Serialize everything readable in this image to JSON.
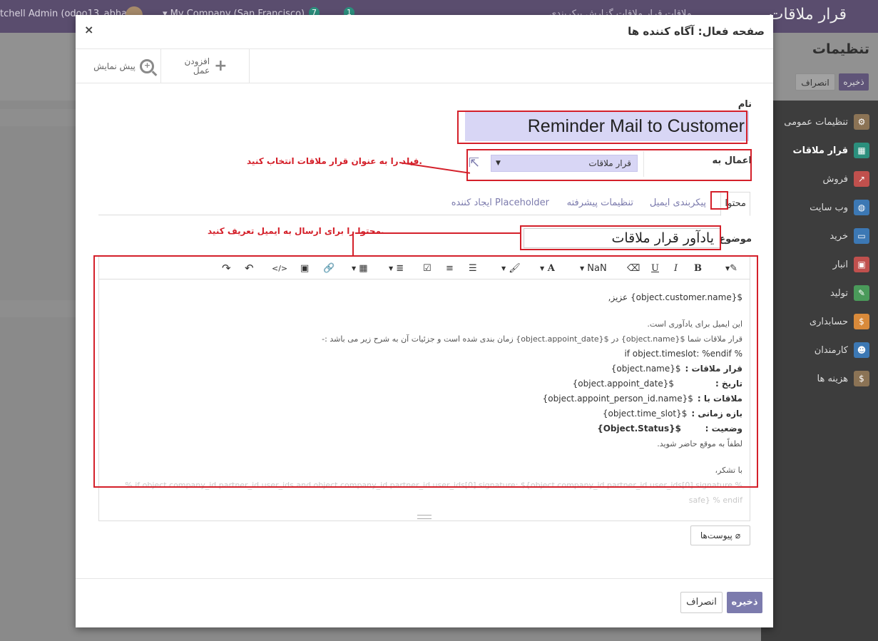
{
  "topbar": {
    "user": "tchell Admin (odoo13_abhasi)",
    "company": "▾ My Company (San Francisco)",
    "badge_msgs": "7",
    "badge_activity": "1",
    "menu_text": "ملاقات  قرار ملاقات  گزارش  پیکربندی",
    "brand": "قرار ملاقات"
  },
  "background": {
    "title": "تنظیمات",
    "save": "ذخیره",
    "cancel": "انصراف"
  },
  "sidebar": {
    "items": [
      {
        "label": "تنظیمات عمومی",
        "icon": "gear-icon",
        "color": "#8b7355"
      },
      {
        "label": "قرار ملاقات",
        "icon": "calendar-icon",
        "color": "#2b8f7d"
      },
      {
        "label": "فروش",
        "icon": "chart-icon",
        "color": "#c0504d"
      },
      {
        "label": "وب سایت",
        "icon": "globe-icon",
        "color": "#3c78b4"
      },
      {
        "label": "خرید",
        "icon": "card-icon",
        "color": "#3c78b4"
      },
      {
        "label": "انبار",
        "icon": "box-icon",
        "color": "#c0504d"
      },
      {
        "label": "تولید",
        "icon": "wrench-icon",
        "color": "#4a9a5a"
      },
      {
        "label": "حسابداری",
        "icon": "invoice-icon",
        "color": "#d98a3a"
      },
      {
        "label": "کارمندان",
        "icon": "people-icon",
        "color": "#3c78b4"
      },
      {
        "label": "هزینه ها",
        "icon": "expense-icon",
        "color": "#8b7355"
      }
    ]
  },
  "modal": {
    "title": "صفحه فعال: آگاه کننده ها",
    "close": "×",
    "preview": "پیش نمایش",
    "add_action": "افزودن\nعمل",
    "name_label": "نام",
    "name_value": "Reminder Mail to Customer",
    "apply_label": "اعمال به",
    "apply_value": "قرار ملاقات",
    "tabs": [
      "محتوا",
      "پیکربندی ایمیل",
      "تنظیمات پیشرفته",
      "ایجاد کننده Placeholder"
    ],
    "subject_label": "موضوع",
    "subject_value": "یادآور قرار ملاقات",
    "toolbar": {
      "style": "✎",
      "bold": "B",
      "italic": "I",
      "underline": "U",
      "eraser": "⌫",
      "font_size": "NaN",
      "font_color": "A",
      "brush": "🖌",
      "ul": "☰",
      "ol": "≡",
      "check": "☑",
      "align": "≣",
      "table": "▦",
      "link": "🔗",
      "image": "▣",
      "code": "</>",
      "undo": "↶",
      "redo": "↷"
    },
    "body": {
      "greet": "${object.customer.name} عزیز,",
      "l1": "این ایمیل برای یادآوری است.",
      "l2": "قرار ملاقات شما ${object.name} در ${object.appoint_date} زمان بندی شده است و جزئیات آن به شرح زیر می باشد :-",
      "l3": "% if object.timeslot: %endif",
      "r1k": "قرار ملاقات :",
      "r1v": "${object.name}",
      "r2k": "تاریخ :",
      "r2v": "${object.appoint_date}",
      "r3k": "ملاقات با :",
      "r3v": "${object.appoint_person_id.name}",
      "r4k": "بازه زمانی :",
      "r4v": "${object.time_slot}",
      "r5k": "وضعیت :",
      "r5v": "${Object.Status}",
      "l4": "لطفاً به موقع حاضر شوید.",
      "l5": "با تشکر،",
      "sig1": "% if object.company_id.partner_id.user_ids and object.company_id.partner_id.user_ids[0].signature: ${object.company_id.partner_id.user_ids[0].signature %",
      "sig2": "safe} % endif"
    },
    "attachments": "پیوست‌ها",
    "footer_save": "ذخیره",
    "footer_cancel": "انصراف"
  },
  "annotations": {
    "note_apply": "فیلد را به عنوان قرار ملاقات انتخاب کنید.",
    "note_content": "محتوا را برای ارسال به ایمیل تعریف کنید.",
    "color": "#d4202a"
  }
}
